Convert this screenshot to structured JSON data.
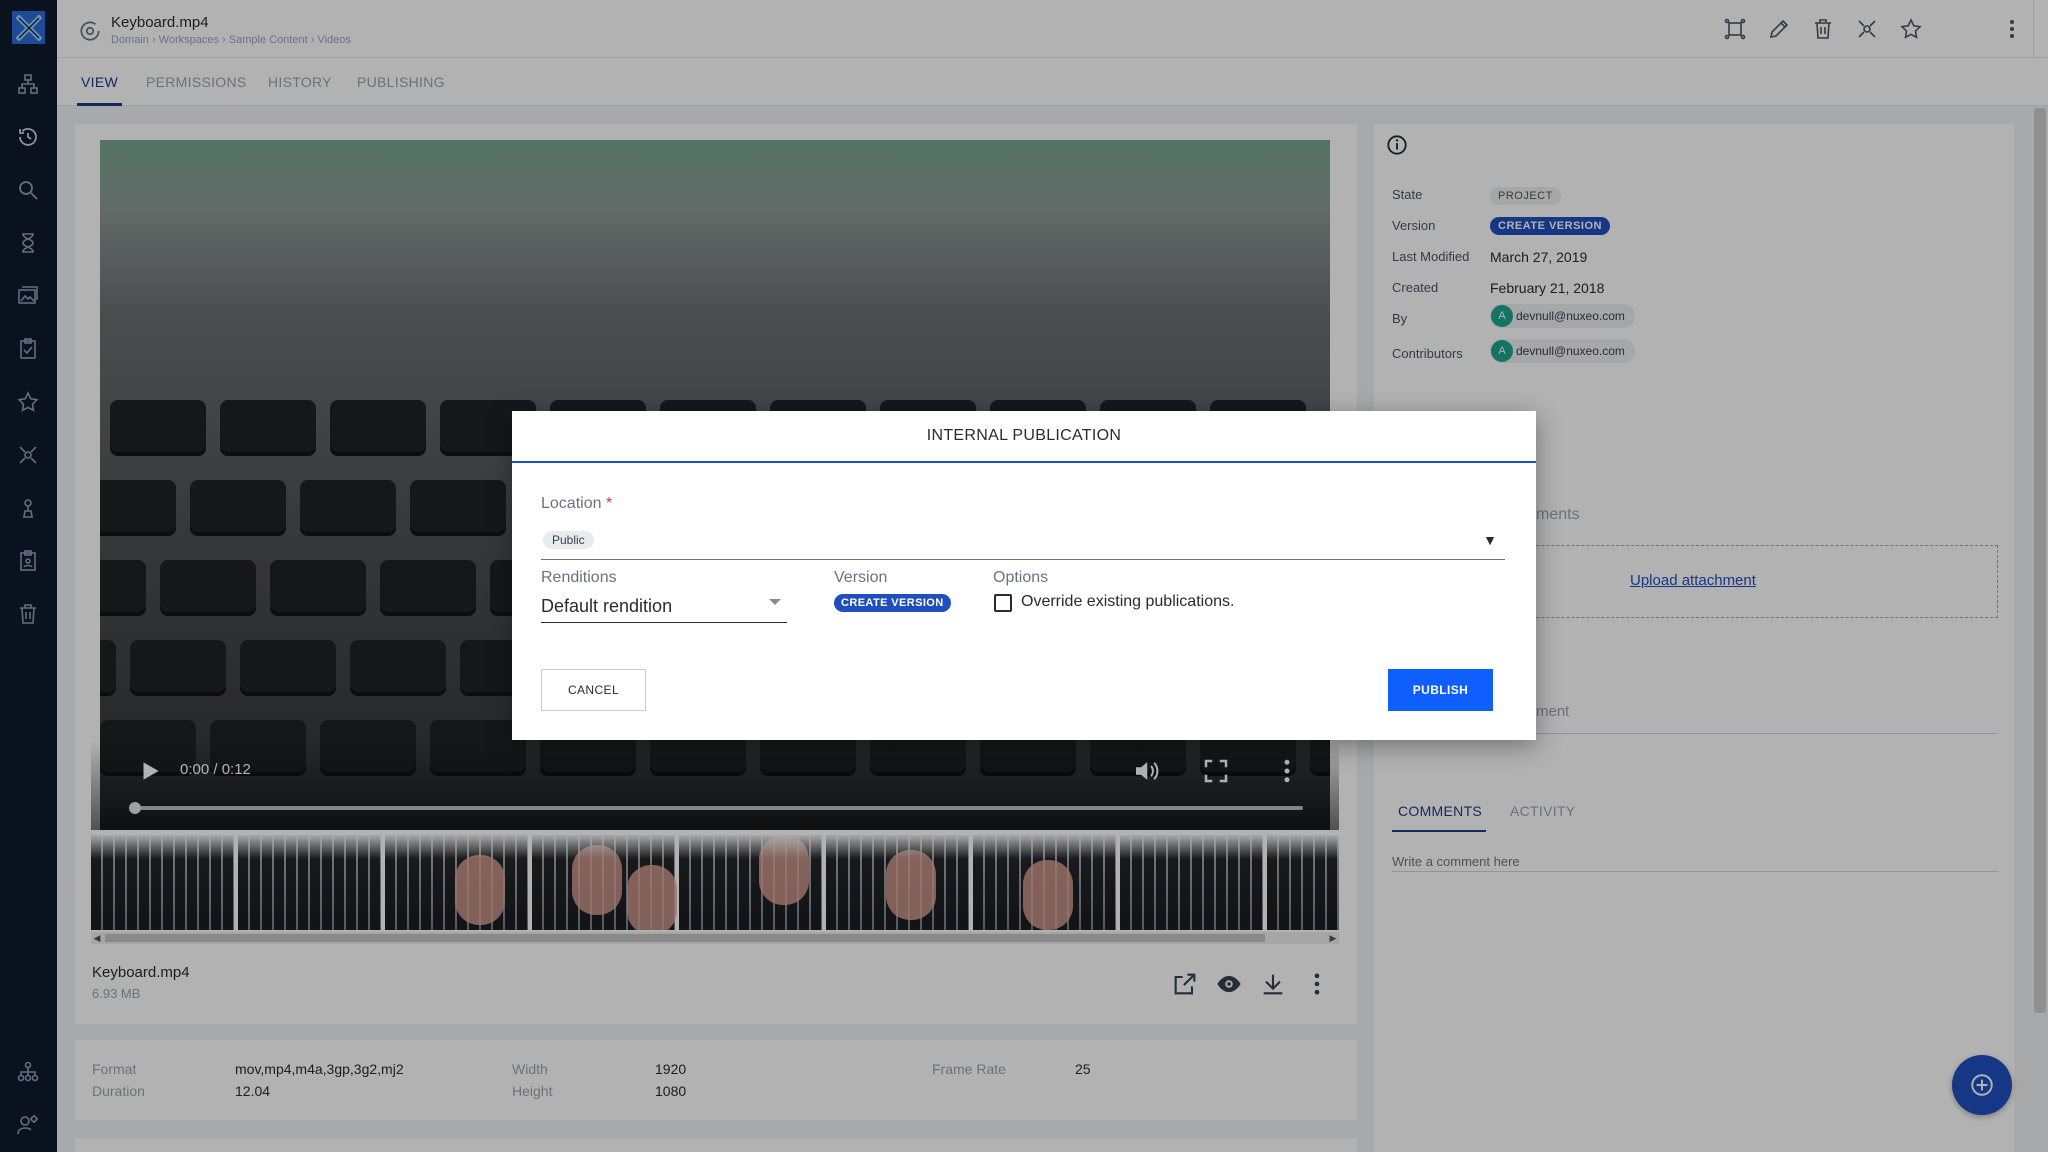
{
  "header": {
    "title": "Keyboard.mp4",
    "breadcrumb": "Domain  ›  Workspaces  ›  Sample Content  ›  Videos",
    "actions": [
      "compare-icon",
      "edit-icon",
      "delete-icon",
      "share-icon",
      "favorite-icon",
      "more-icon",
      "search-icon"
    ]
  },
  "tabs": [
    {
      "label": "VIEW",
      "active": true
    },
    {
      "label": "PERMISSIONS",
      "active": false
    },
    {
      "label": "HISTORY",
      "active": false
    },
    {
      "label": "PUBLISHING",
      "active": false
    }
  ],
  "sidebar": {
    "items": [
      "browse-icon",
      "recent-icon",
      "search-icon",
      "tasks-icon",
      "collections-icon",
      "clipboard-icon",
      "favorites-icon",
      "sharing-icon",
      "profile-icon",
      "document-icon",
      "trash-icon",
      "administration-icon",
      "user-settings-icon"
    ]
  },
  "viewer": {
    "time": "0:00 / 0:12",
    "progress_fraction": 0.0,
    "file_name": "Keyboard.mp4",
    "file_size": "6.93 MB"
  },
  "metadata": {
    "format_label": "Format",
    "format_value": "mov,mp4,m4a,3gp,3g2,mj2",
    "duration_label": "Duration",
    "duration_value": "12.04",
    "width_label": "Width",
    "width_value": "1920",
    "height_label": "Height",
    "height_value": "1080",
    "framerate_label": "Frame Rate",
    "framerate_value": "25"
  },
  "properties": {
    "state_label": "State",
    "state_value": "PROJECT",
    "version_label": "Version",
    "version_value": "CREATE VERSION",
    "modified_label": "Last Modified",
    "modified_value": "March 27, 2019",
    "created_label": "Created",
    "created_value": "February 21, 2018",
    "by_label": "By",
    "by_value": "devnull@nuxeo.com",
    "by_avatar": "A",
    "contributors_label": "Contributors",
    "contributors_value": "devnull@nuxeo.com",
    "contributors_avatar": "A"
  },
  "attachments": {
    "title_partial": "ments",
    "upload_label": "Upload attachment"
  },
  "comments": {
    "partial_label": "ment",
    "tabs": [
      "COMMENTS",
      "ACTIVITY"
    ],
    "placeholder": "Write a comment here"
  },
  "dialog": {
    "title": "INTERNAL PUBLICATION",
    "location_label": "Location",
    "required_mark": "*",
    "location_value": "Public",
    "renditions_label": "Renditions",
    "renditions_value": "Default rendition",
    "version_label": "Version",
    "version_value": "CREATE VERSION",
    "options_label": "Options",
    "override_label": "Override existing publications.",
    "override_checked": false,
    "cancel_label": "CANCEL",
    "publish_label": "PUBLISH"
  },
  "colors": {
    "accent": "#1f4fbf",
    "publish": "#0f5fff",
    "nav_bg": "#0e1a2b"
  }
}
